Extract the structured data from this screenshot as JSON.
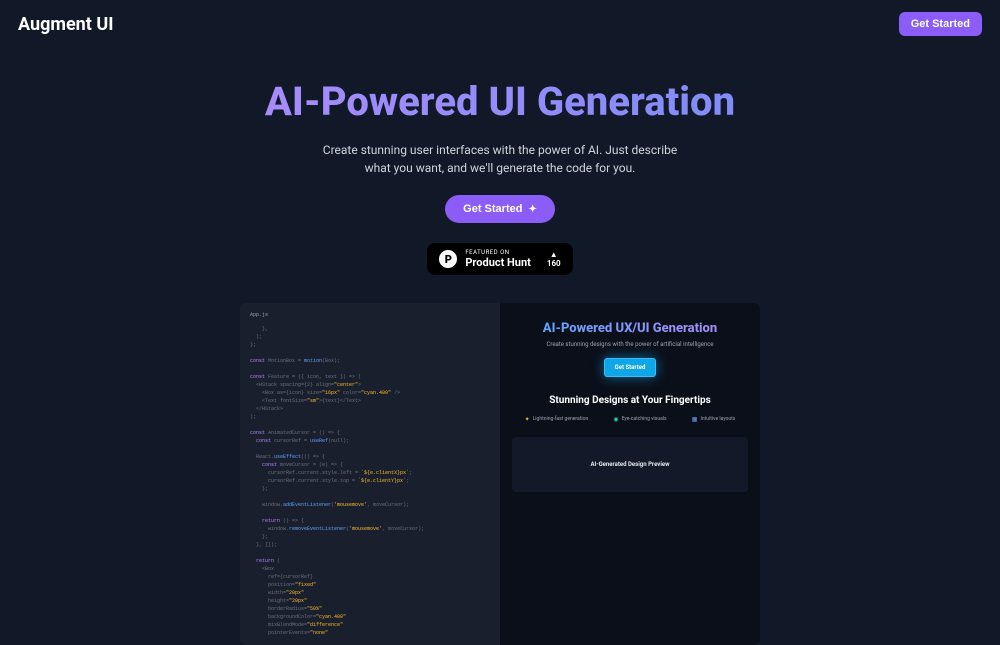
{
  "header": {
    "logo": "Augment UI",
    "cta": "Get Started"
  },
  "hero": {
    "title": "AI-Powered UI Generation",
    "subtitle": "Create stunning user interfaces with the power of AI. Just describe what you want, and we'll generate the code for you.",
    "cta": "Get Started"
  },
  "producthunt": {
    "featured": "FEATURED ON",
    "name": "Product Hunt",
    "upvotes": "160"
  },
  "demo": {
    "filename": "App.js",
    "preview": {
      "title": "AI-Powered UX/UI Generation",
      "subtitle": "Create stunning designs with the power of artificial intelligence",
      "cta": "Get Started",
      "section": "Stunning Designs at Your Fingertips",
      "features": [
        "Lightning-fast generation",
        "Eye-catching visuals",
        "Intuitive layouts"
      ],
      "preview_label": "AI-Generated Design Preview"
    }
  }
}
